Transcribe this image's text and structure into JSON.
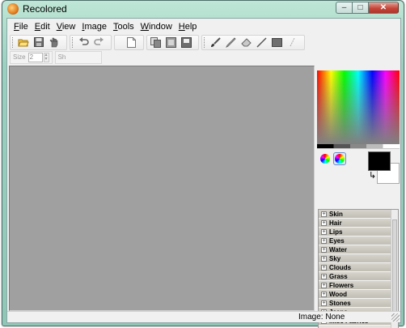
{
  "window": {
    "title": "Recolored",
    "icon": "app-icon"
  },
  "caption": {
    "minimize": "–",
    "maximize": "□",
    "close": "✕"
  },
  "menu": [
    "File",
    "Edit",
    "View",
    "Image",
    "Tools",
    "Window",
    "Help"
  ],
  "toolbar": {
    "group1": [
      "open-icon",
      "save-icon",
      "hand-icon"
    ],
    "group2": [
      "undo-icon",
      "redo-icon"
    ],
    "group3": [
      "page-icon"
    ],
    "group4": [
      "copy-icon",
      "layers-icon",
      "export-icon"
    ],
    "group5": [
      "brush-icon",
      "pencil-icon",
      "eraser-icon",
      "line-icon",
      "fill-rect-icon",
      "selection-icon"
    ]
  },
  "toolbar2": {
    "size_label": "Size",
    "size_value": "2",
    "sh_label": "Sh"
  },
  "colors": {
    "foreground": "#000000",
    "background": "#ffffff"
  },
  "categories": [
    "Skin",
    "Hair",
    "Lips",
    "Eyes",
    "Water",
    "Sky",
    "Clouds",
    "Grass",
    "Flowers",
    "Wood",
    "Stones",
    "Jeans",
    "Misc Fabrics"
  ],
  "status": {
    "image_label": "Image: None"
  }
}
